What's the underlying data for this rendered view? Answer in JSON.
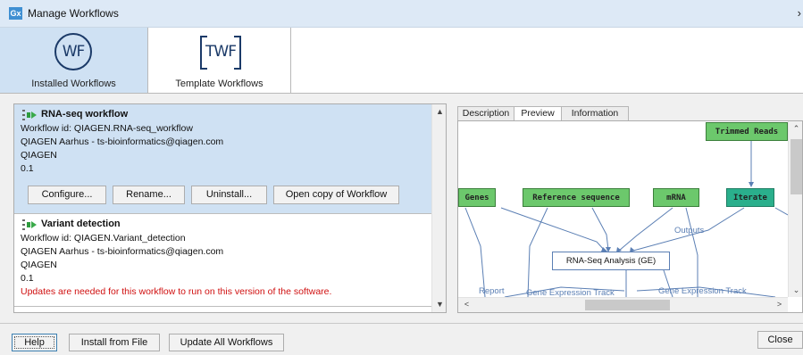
{
  "window": {
    "title": "Manage Workflows",
    "logo": "Gx",
    "collapse_glyph": "›"
  },
  "tabs": [
    {
      "label": "Installed Workflows",
      "icon": "WF",
      "active": true
    },
    {
      "label": "Template Workflows",
      "icon": "TWF",
      "active": false
    }
  ],
  "workflows": [
    {
      "name": "RNA-seq workflow",
      "id_line": "Workflow id: QIAGEN.RNA-seq_workflow",
      "author_line": "QIAGEN Aarhus - ts-bioinformatics@qiagen.com",
      "vendor": "QIAGEN",
      "version": "0.1",
      "selected": true,
      "buttons": {
        "configure": "Configure...",
        "rename": "Rename...",
        "uninstall": "Uninstall...",
        "open_copy": "Open copy of Workflow"
      }
    },
    {
      "name": "Variant detection",
      "id_line": "Workflow id: QIAGEN.Variant_detection",
      "author_line": "QIAGEN Aarhus - ts-bioinformatics@qiagen.com",
      "vendor": "QIAGEN",
      "version": "0.1",
      "warning": "Updates are needed for this workflow to run on this version of the software.",
      "selected": false
    }
  ],
  "detail_tabs": [
    {
      "label": "Description",
      "active": false
    },
    {
      "label": "Preview",
      "active": true
    },
    {
      "label": "Information",
      "active": false
    }
  ],
  "preview": {
    "nodes": {
      "trimmed_reads": "Trimmed Reads",
      "genes": "Genes",
      "reference_sequence": "Reference sequence",
      "mrna": "mRNA",
      "iterate": "Iterate",
      "rna_seq_analysis": "RNA-Seq Analysis (GE)"
    },
    "edge_labels": {
      "outputs": "Outputs",
      "report": "Report",
      "gene_expr_1": "Gene Expression Track",
      "gene_expr_2": "Gene Expression Track"
    }
  },
  "footer": {
    "help": "Help",
    "install_from_file": "Install from File",
    "update_all": "Update All Workflows",
    "close": "Close"
  },
  "colors": {
    "selection": "#cfe1f3",
    "node_green": "#6cc86c",
    "node_teal": "#2aaf8c",
    "warning_red": "#d01010",
    "edge_blue": "#5b7fb4"
  }
}
